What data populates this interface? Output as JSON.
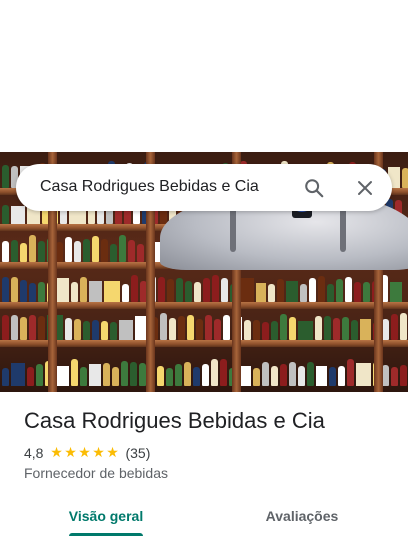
{
  "search": {
    "query": "Casa Rodrigues Bebidas e Cia",
    "search_icon": "search-icon",
    "clear_icon": "close-icon"
  },
  "hero": {
    "image": "store-photo"
  },
  "place": {
    "name": "Casa Rodrigues Bebidas e Cia",
    "rating": "4,8",
    "stars": 5,
    "review_count": "(35)",
    "category": "Fornecedor de bebidas"
  },
  "tabs": [
    {
      "label": "Visão geral",
      "active": true
    },
    {
      "label": "Avaliações",
      "active": false
    }
  ],
  "colors": {
    "accent": "#00796b",
    "star": "#fbbc04",
    "text_primary": "#202124",
    "text_secondary": "#5f6368"
  }
}
